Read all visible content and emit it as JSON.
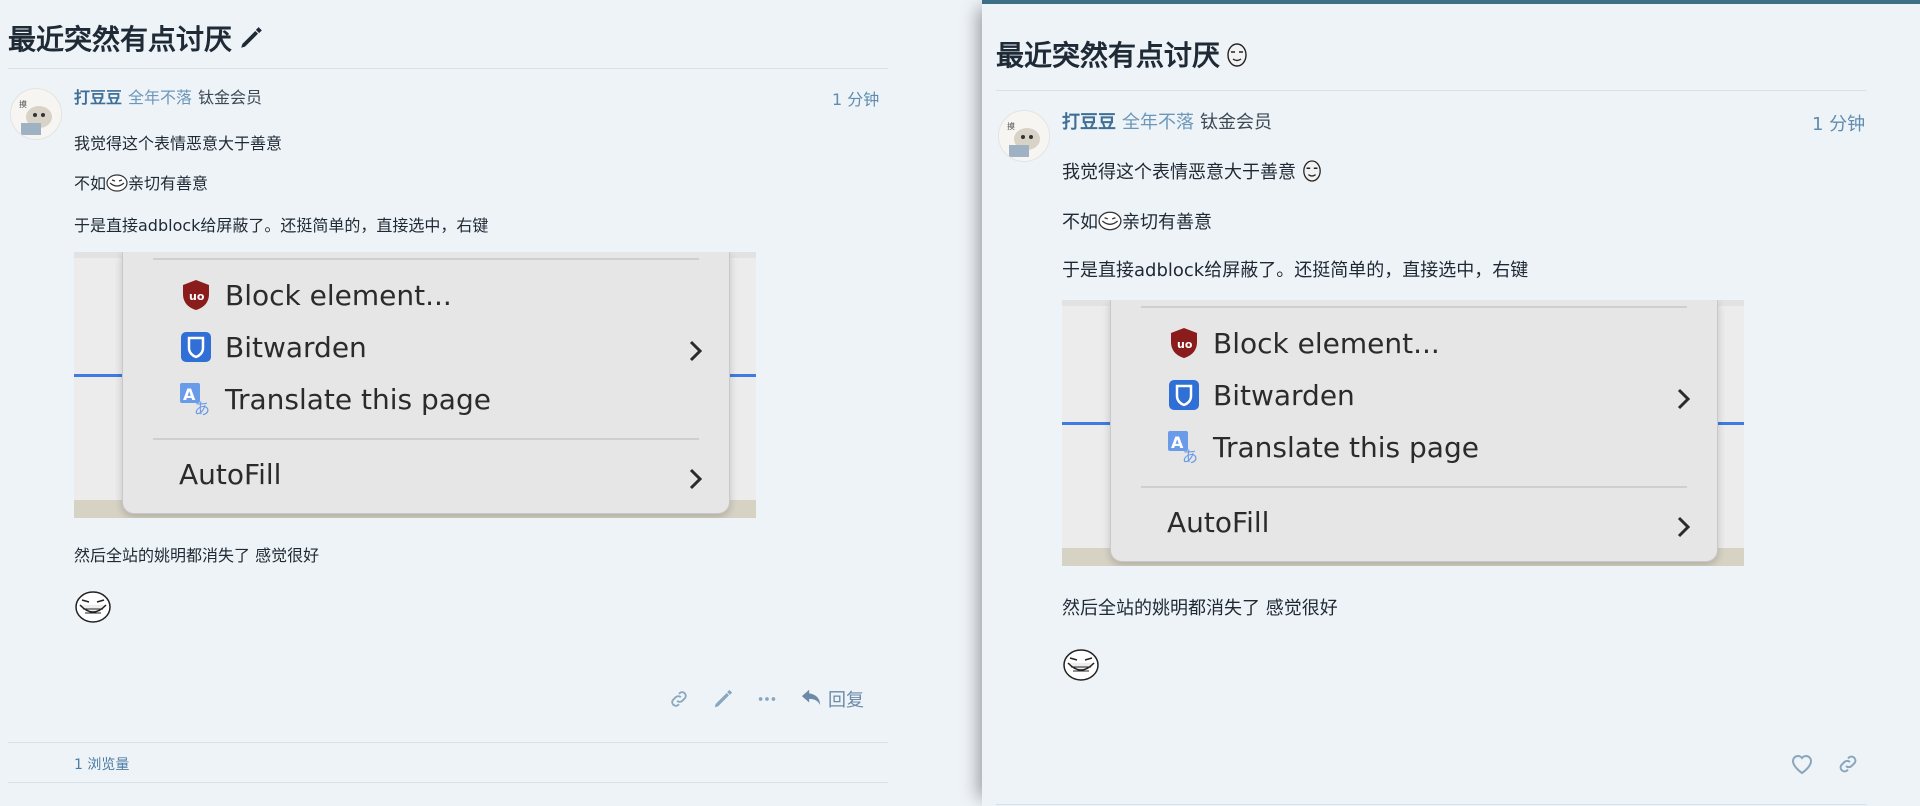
{
  "left": {
    "title": "最近突然有点讨厌",
    "author": {
      "name": "打豆豆",
      "flair": "全年不落",
      "badge": "钛金会员"
    },
    "time": "1 分钟",
    "p1": "我觉得这个表情恶意大于善意",
    "p2_prefix": "不如",
    "p2_suffix": "亲切有善意",
    "p3": "于是直接adblock给屏蔽了。还挺简单的，直接选中，右键",
    "menu": {
      "block": "Block element...",
      "bitwarden": "Bitwarden",
      "translate": "Translate this page",
      "autofill": "AutoFill"
    },
    "p4": "然后全站的姚明都消失了 感觉很好",
    "reply": "回复",
    "views": "1 浏览量"
  },
  "right": {
    "title": "最近突然有点讨厌",
    "author": {
      "name": "打豆豆",
      "flair": "全年不落",
      "badge": "钛金会员"
    },
    "time": "1 分钟",
    "p1": "我觉得这个表情恶意大于善意",
    "p2_prefix": "不如",
    "p2_suffix": "亲切有善意",
    "p3": "于是直接adblock给屏蔽了。还挺简单的，直接选中，右键",
    "menu": {
      "block": "Block element...",
      "bitwarden": "Bitwarden",
      "translate": "Translate this page",
      "autofill": "AutoFill"
    },
    "p4": "然后全站的姚明都消失了 感觉很好"
  },
  "icons": {
    "edit": "pencil-icon",
    "link": "link-icon",
    "more": "ellipsis-icon",
    "reply": "reply-arrow-icon",
    "like": "heart-icon",
    "ublock": "ublock-shield-icon",
    "bitwarden": "bitwarden-shield-icon",
    "translate": "translate-icon",
    "chevron": "chevron-right-icon"
  },
  "colors": {
    "accent": "#3f6f96",
    "link": "#5e8db0",
    "menu_line": "#3f7be0"
  }
}
